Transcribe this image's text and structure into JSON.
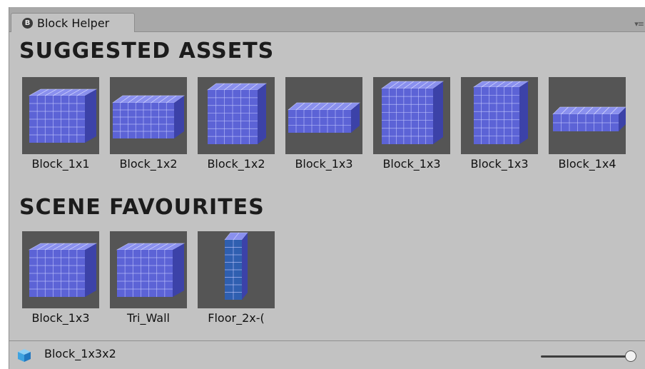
{
  "window": {
    "tab_title": "Block Helper",
    "tab_icon_glyph": "B",
    "menu_glyph": "▾≡"
  },
  "suggested": {
    "title": "SUGGESTED ASSETS",
    "items": [
      {
        "label": "Block_1x1",
        "shape": "cube"
      },
      {
        "label": "Block_1x2",
        "shape": "wide"
      },
      {
        "label": "Block_1x2",
        "shape": "tall"
      },
      {
        "label": "Block_1x3",
        "shape": "long"
      },
      {
        "label": "Block_1x3",
        "shape": "tallwide"
      },
      {
        "label": "Block_1x3",
        "shape": "tallnarrow"
      },
      {
        "label": "Block_1x4",
        "shape": "verylong"
      }
    ]
  },
  "favourites": {
    "title": "SCENE FAVOURITES",
    "items": [
      {
        "label": "Block_1x3",
        "shape": "cube"
      },
      {
        "label": "Tri_Wall",
        "shape": "cube"
      },
      {
        "label": "Floor_2x-(",
        "shape": "panel"
      }
    ]
  },
  "status": {
    "selected": "Block_1x3x2",
    "icon": "cube-icon",
    "zoom_fraction": 0.95
  },
  "colors": {
    "block_front": "#5c63d6",
    "block_top": "#8a90ee",
    "block_side": "#3c42a8",
    "panel_front": "#2f5fb0",
    "thumb_bg": "#555555"
  }
}
